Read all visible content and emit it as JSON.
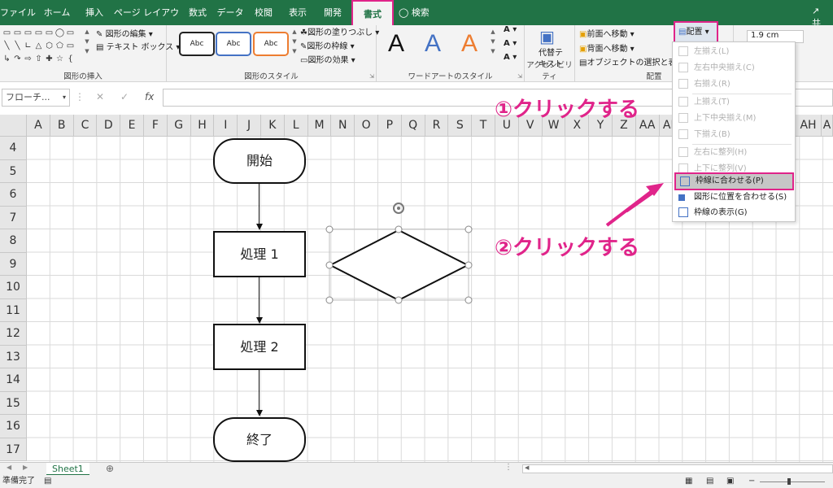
{
  "tabs": [
    "ファイル",
    "ホーム",
    "挿入",
    "ページ レイアウト",
    "数式",
    "データ",
    "校閲",
    "表示",
    "開発",
    "書式"
  ],
  "search_label": "検索",
  "share_label": "共",
  "ribbon": {
    "insert_shapes": {
      "edit_shape": "図形の編集",
      "text_box": "テキスト ボックス",
      "label": "図形の挿入"
    },
    "shape_styles": {
      "samples": [
        "Abc",
        "Abc",
        "Abc"
      ],
      "fill": "図形の塗りつぶし",
      "outline": "図形の枠線",
      "effects": "図形の効果",
      "label": "図形のスタイル"
    },
    "wordart": {
      "letters": [
        "A",
        "A",
        "A"
      ],
      "label": "ワードアートのスタイル"
    },
    "accessibility": {
      "alt_text_line1": "代替テ",
      "alt_text_line2": "キスト",
      "label": "アクセシビリティ"
    },
    "arrange": {
      "bring_forward": "前面へ移動",
      "send_backward": "背面へ移動",
      "selection_pane": "オブジェクトの選択と表示",
      "align": "配置",
      "label": "配置"
    },
    "size": {
      "height": "1.9 cm"
    }
  },
  "formula_bar": {
    "name_box": "フローチ...",
    "fx": "fx"
  },
  "columns": [
    "A",
    "B",
    "C",
    "D",
    "E",
    "F",
    "G",
    "H",
    "I",
    "J",
    "K",
    "L",
    "M",
    "N",
    "O",
    "P",
    "Q",
    "R",
    "S",
    "T",
    "U",
    "V",
    "W",
    "X",
    "Y",
    "Z",
    "AA",
    "AB",
    "AH",
    "A"
  ],
  "rows": [
    "4",
    "5",
    "6",
    "7",
    "8",
    "9",
    "10",
    "11",
    "12",
    "13",
    "14",
    "15",
    "16",
    "17"
  ],
  "flowchart": {
    "start": "開始",
    "process1": "処理 1",
    "process2": "処理 2",
    "end": "終了"
  },
  "align_menu": {
    "items": [
      {
        "label": "左揃え(L)",
        "enabled": false
      },
      {
        "label": "左右中央揃え(C)",
        "enabled": false
      },
      {
        "label": "右揃え(R)",
        "enabled": false
      },
      {
        "label": "上揃え(T)",
        "enabled": false
      },
      {
        "label": "上下中央揃え(M)",
        "enabled": false
      },
      {
        "label": "下揃え(B)",
        "enabled": false
      },
      {
        "label": "左右に整列(H)",
        "enabled": false
      },
      {
        "label": "上下に整列(V)",
        "enabled": false
      },
      {
        "label": "枠線に合わせる(P)",
        "enabled": true
      },
      {
        "label": "図形に位置を合わせる(S)",
        "enabled": true
      },
      {
        "label": "枠線の表示(G)",
        "enabled": true
      }
    ]
  },
  "annotations": {
    "step1": "①クリックする",
    "step2": "②クリックする"
  },
  "sheet_tab": "Sheet1",
  "status": "準備完了",
  "colors": {
    "excel_green": "#217346",
    "highlight_pink": "#e0248a"
  }
}
